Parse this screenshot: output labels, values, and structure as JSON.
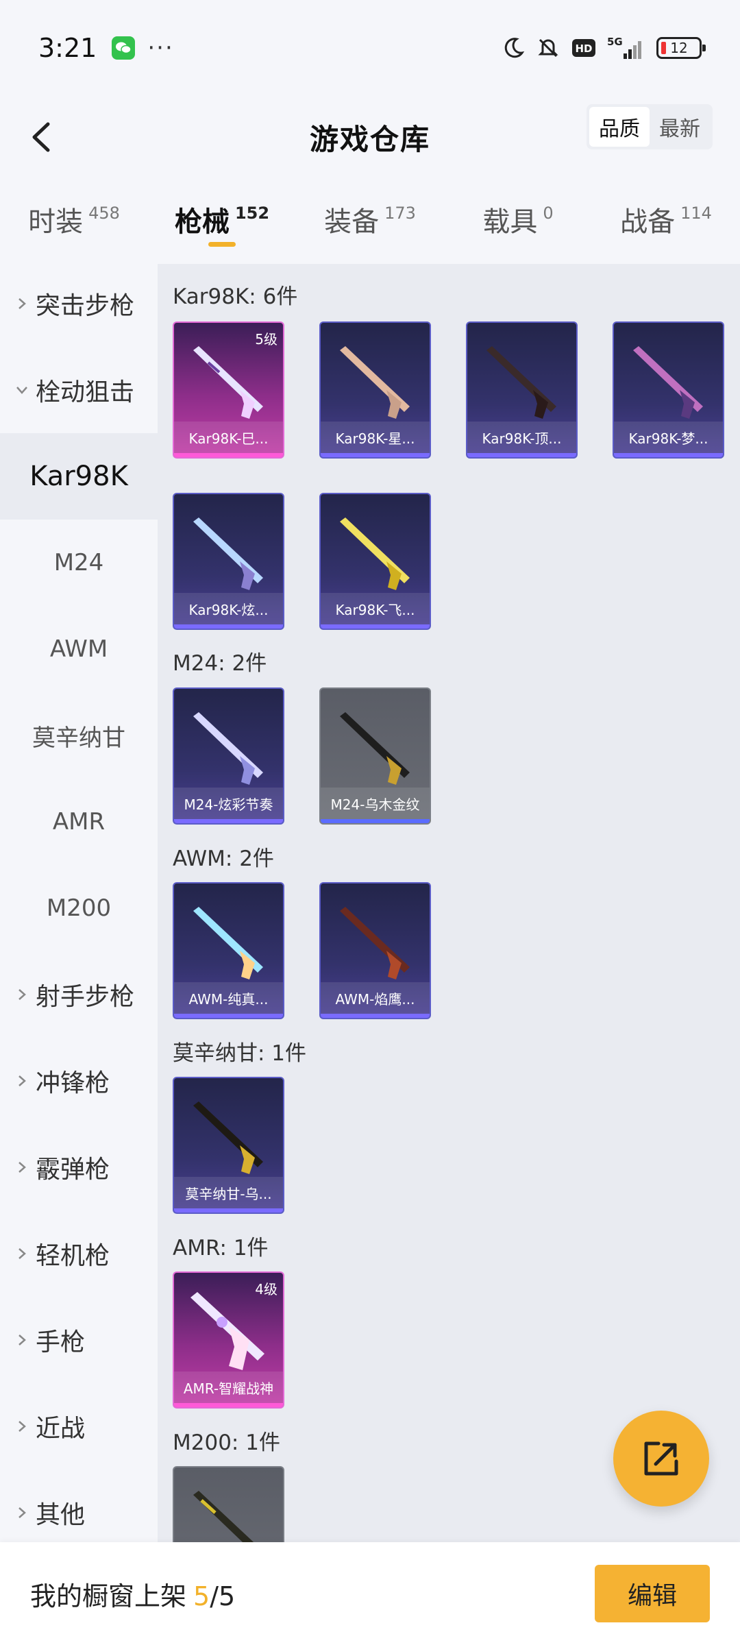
{
  "status": {
    "time": "3:21",
    "dots": "···",
    "battery": "12",
    "network": "5G"
  },
  "header": {
    "title": "游戏仓库",
    "sort": [
      "品质",
      "最新"
    ]
  },
  "tabs": [
    {
      "label": "时装",
      "count": "458"
    },
    {
      "label": "枪械",
      "count": "152"
    },
    {
      "label": "装备",
      "count": "173"
    },
    {
      "label": "载具",
      "count": "0"
    },
    {
      "label": "战备",
      "count": "114"
    }
  ],
  "sidebar": {
    "items": [
      {
        "label": "突击步枪"
      },
      {
        "label": "栓动狙击"
      },
      {
        "label": "Kar98K"
      },
      {
        "label": "M24"
      },
      {
        "label": "AWM"
      },
      {
        "label": "莫辛纳甘"
      },
      {
        "label": "AMR"
      },
      {
        "label": "M200"
      },
      {
        "label": "射手步枪"
      },
      {
        "label": "冲锋枪"
      },
      {
        "label": "霰弹枪"
      },
      {
        "label": "轻机枪"
      },
      {
        "label": "手枪"
      },
      {
        "label": "近战"
      },
      {
        "label": "其他"
      }
    ]
  },
  "sections": [
    {
      "title": "Kar98K: 6件",
      "items": [
        {
          "name": "Kar98K-巳...",
          "level": "5级"
        },
        {
          "name": "Kar98K-星..."
        },
        {
          "name": "Kar98K-顶..."
        },
        {
          "name": "Kar98K-梦..."
        },
        {
          "name": "Kar98K-炫..."
        },
        {
          "name": "Kar98K-飞..."
        }
      ]
    },
    {
      "title": "M24: 2件",
      "items": [
        {
          "name": "M24-炫彩节奏"
        },
        {
          "name": "M24-乌木金纹"
        }
      ]
    },
    {
      "title": "AWM: 2件",
      "items": [
        {
          "name": "AWM-纯真..."
        },
        {
          "name": "AWM-焰鹰..."
        }
      ]
    },
    {
      "title": "莫辛纳甘: 1件",
      "items": [
        {
          "name": "莫辛纳甘-乌..."
        }
      ]
    },
    {
      "title": "AMR: 1件",
      "items": [
        {
          "name": "AMR-智耀战神",
          "level": "4级"
        }
      ]
    },
    {
      "title": "M200: 1件",
      "items": [
        {
          "name": ""
        }
      ]
    }
  ],
  "bottom": {
    "label": "我的橱窗上架",
    "count": "5",
    "total": "/5",
    "edit": "编辑"
  },
  "colors": {
    "accent": "#f5b233",
    "count_highlight": "#f2b12a"
  }
}
